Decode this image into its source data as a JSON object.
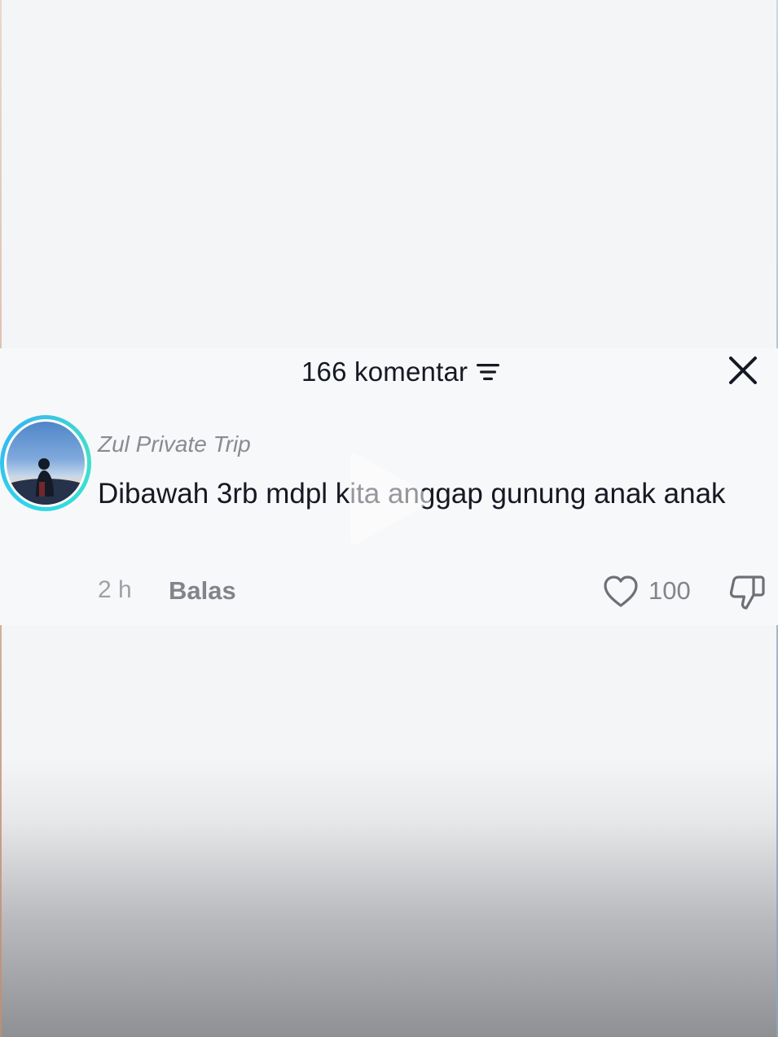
{
  "header": {
    "comment_count": "166 komentar",
    "sort_icon": "sort-filter-icon",
    "close_icon": "close-icon"
  },
  "comment": {
    "avatar_icon": "user-avatar",
    "username": "Zul Private Trip",
    "text": "Dibawah 3rb mdpl kita anggap gunung anak anak",
    "time": "2 h",
    "reply_label": "Balas",
    "like_count": "100",
    "like_icon": "heart-outline-icon",
    "dislike_icon": "thumbs-down-icon"
  },
  "overlay": {
    "play_icon": "play-icon"
  },
  "colors": {
    "text_primary": "#161823",
    "text_secondary": "#83848a",
    "avatar_ring": "#2fd6e8"
  }
}
